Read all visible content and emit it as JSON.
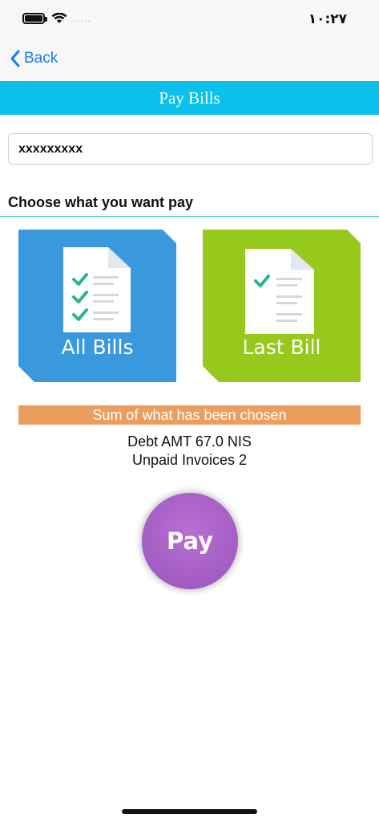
{
  "status_bar": {
    "time": "١٠:٢٧",
    "signal": "....."
  },
  "nav": {
    "back_label": "Back"
  },
  "header": {
    "title": "Pay Bills"
  },
  "account": {
    "value": "xxxxxxxxx"
  },
  "section": {
    "heading": "Choose what you want pay"
  },
  "tiles": [
    {
      "label": "All Bills",
      "color": "#3a98dd",
      "checks": 3
    },
    {
      "label": "Last Bill",
      "color": "#97c81c",
      "checks": 1
    }
  ],
  "summary": {
    "label": "Sum of what has been chosen",
    "debt": "Debt AMT 67.0  NIS",
    "unpaid": "Unpaid Invoices 2"
  },
  "pay": {
    "label": "Pay",
    "color": "#a35cc2"
  }
}
